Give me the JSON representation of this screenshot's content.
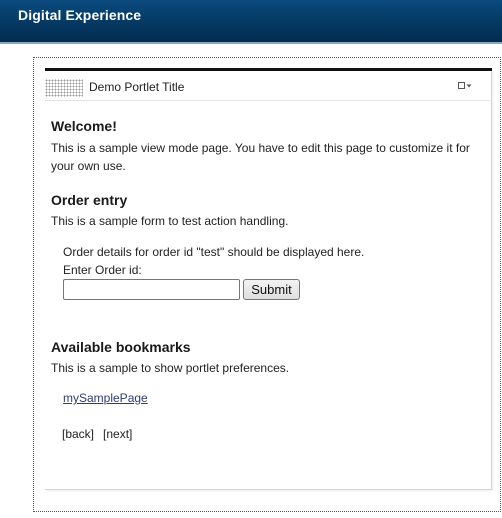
{
  "header": {
    "brand": "Digital Experience"
  },
  "portlet": {
    "title": "Demo Portlet Title",
    "menu_icon": "portlet-menu-icon"
  },
  "welcome": {
    "heading": "Welcome!",
    "text": "This is a sample view mode page. You have to edit this page to customize it for your own use."
  },
  "order": {
    "heading": "Order entry",
    "text": "This is a sample form to test action handling.",
    "details": "Order details for order id \"test\" should be displayed here.",
    "input_label": "Enter Order id:",
    "input_value": "",
    "submit_label": "Submit"
  },
  "bookmarks": {
    "heading": "Available bookmarks",
    "text": "This is a sample to show portlet preferences.",
    "link_label": "mySamplePage"
  },
  "pager": {
    "back_label": "[back]",
    "next_label": "[next]"
  }
}
